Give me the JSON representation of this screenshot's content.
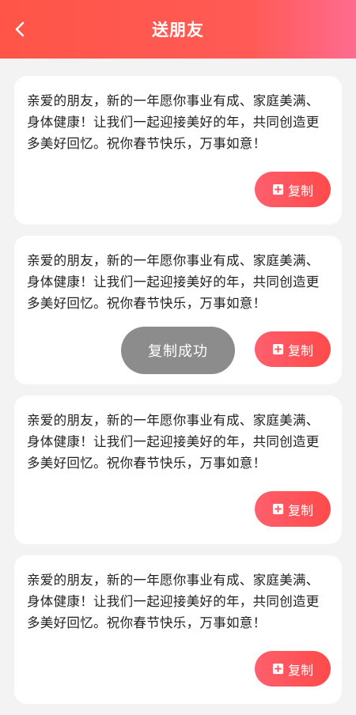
{
  "header": {
    "title": "送朋友",
    "back_icon": "chevron-left-icon"
  },
  "colors": {
    "accent": "#ff5548",
    "accent_end": "#ff6b8f",
    "toast_bg": "#787878"
  },
  "cards": [
    {
      "text": "亲爱的朋友，新的一年愿你事业有成、家庭美满、身体健康！让我们一起迎接美好的年，共同创造更多美好回忆。祝你春节快乐，万事如意！",
      "copy_label": "复制",
      "copy_icon": "copy-icon"
    },
    {
      "text": "亲爱的朋友，新的一年愿你事业有成、家庭美满、身体健康！让我们一起迎接美好的年，共同创造更多美好回忆。祝你春节快乐，万事如意！",
      "copy_label": "复制",
      "copy_icon": "copy-icon"
    },
    {
      "text": "亲爱的朋友，新的一年愿你事业有成、家庭美满、身体健康！让我们一起迎接美好的年，共同创造更多美好回忆。祝你春节快乐，万事如意！",
      "copy_label": "复制",
      "copy_icon": "copy-icon"
    },
    {
      "text": "亲爱的朋友，新的一年愿你事业有成、家庭美满、身体健康！让我们一起迎接美好的年，共同创造更多美好回忆。祝你春节快乐，万事如意！",
      "copy_label": "复制",
      "copy_icon": "copy-icon"
    }
  ],
  "toast": {
    "text": "复制成功"
  }
}
